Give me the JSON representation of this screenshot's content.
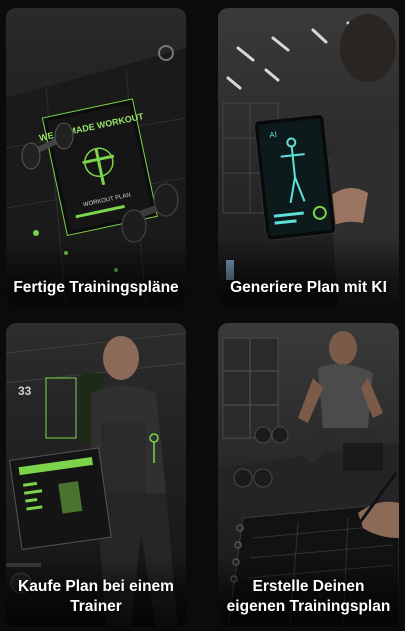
{
  "cards": [
    {
      "title": "Fertige Trainingspläne",
      "image": "workout-book-dumbbells-image",
      "cover_title": "WEAK MADE WORKOUT",
      "cover_subtitle": "WORKOUT PLAN"
    },
    {
      "title": "Generiere Plan mit KI",
      "image": "ai-tablet-gym-image",
      "tablet_text": "AI"
    },
    {
      "title": "Kaufe Plan bei einem Trainer",
      "image": "trainer-showing-plan-image",
      "wall_number": "33"
    },
    {
      "title": "Erstelle Deinen eigenen Trainingsplan",
      "image": "athlete-writing-plan-image"
    }
  ],
  "colors": {
    "accent": "#7bd44a",
    "background": "#0b0b0b",
    "text": "#ffffff",
    "ai_glow": "#5fe0d8"
  }
}
